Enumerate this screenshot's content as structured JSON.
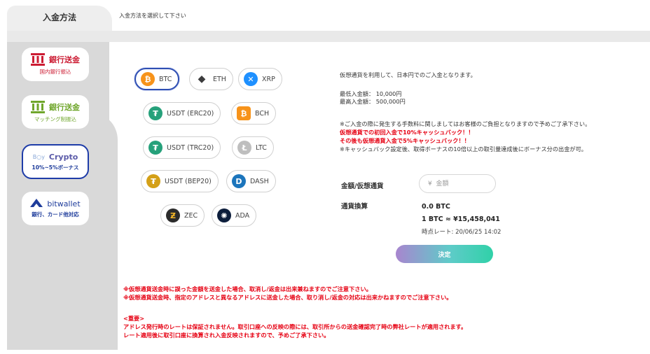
{
  "header": {
    "active_tab": "入金方法",
    "instruction": "入金方法を選択して下さい"
  },
  "sidebar": {
    "items": [
      {
        "title": "銀行送金",
        "sub": "国内銀行振込"
      },
      {
        "title": "銀行送金",
        "sub": "マッチング制振込"
      },
      {
        "title": "Crypto",
        "sub": "10%~5%ボーナス",
        "logo_text": "B○y"
      },
      {
        "title": "bitwallet",
        "sub": "銀行、カード他対応"
      }
    ]
  },
  "coins": [
    {
      "label": "BTC",
      "glyph": "₿",
      "color": "#f7931a"
    },
    {
      "label": "ETH",
      "glyph": "◆",
      "color": "#3c3c3d"
    },
    {
      "label": "XRP",
      "glyph": "✕",
      "color": "#1e90ff"
    },
    {
      "label": "USDT (ERC20)",
      "glyph": "₮",
      "color": "#26a17b"
    },
    {
      "label": "BCH",
      "glyph": "₿",
      "color": "#f7931a"
    },
    {
      "label": "USDT (TRC20)",
      "glyph": "₮",
      "color": "#26a17b"
    },
    {
      "label": "LTC",
      "glyph": "Ł",
      "color": "#bebebe"
    },
    {
      "label": "USDT (BEP20)",
      "glyph": "₮",
      "color": "#d4a017"
    },
    {
      "label": "DASH",
      "glyph": "D",
      "color": "#1c75bc"
    },
    {
      "label": "ZEC",
      "glyph": "Ƶ",
      "color": "#2b2b2b"
    },
    {
      "label": "ADA",
      "glyph": "✺",
      "color": "#0d1e3c"
    }
  ],
  "info": {
    "line1": "仮想通貨を利用して、日本円でのご入金となります。",
    "min": "最低入金額：   10,000円",
    "max": "最高入金額：  500,000円",
    "note1": "※ご入金の際に発生する手数料に関しましてはお客様のご負担となりますので予めご了承下さい。",
    "red1": "仮想通貨での初回入金で10%キャッシュバック！！",
    "red2": "その後も仮想通貨入金で5%キャッシュバック！！",
    "note2": "※キャッシュバック設定後、取得ボーナスの10倍以上の取引量達成後にボーナス分の出金が可。"
  },
  "form": {
    "amount_label": "金額/仮想通貨",
    "amount_placeholder": "¥  金額",
    "conversion_label": "通貨換算",
    "conversion_value": "0.0 BTC",
    "rate": "1 BTC ≈ ¥15,458,041",
    "timestamp": "時点レート: 20/06/25 14:02",
    "submit": "決定"
  },
  "warnings": {
    "w1": "※仮想通貨送金時に誤った金額を送金した場合、取消し/返金は出来兼ねますのでご注意下さい。",
    "w2": "※仮想通貨送金時、指定のアドレスと異なるアドレスに送金した場合、取り消し/返金の対応は出来かねますのでご注意下さい。",
    "important_heading": "<重要>",
    "important1": "アドレス発行時のレートは保証されません。取引口座への反映の際には、取引所からの送金確認完了時の弊社レートが適用されます。",
    "important2": "レート適用後に取引口座に換算され入金反映されますので、予めご了承下さい。"
  },
  "colors": {
    "accent": "#2f4fb3",
    "warning": "#e60012",
    "bank_red": "#cc1c33",
    "bank_green": "#6fa62b"
  }
}
